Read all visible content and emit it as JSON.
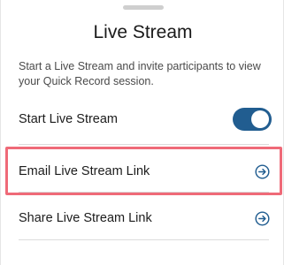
{
  "sheet": {
    "title": "Live Stream",
    "description": "Start a Live Stream and invite participants to view your Quick Record session."
  },
  "rows": {
    "start": {
      "label": "Start Live Stream",
      "toggle_on": true
    },
    "email": {
      "label": "Email Live Stream Link",
      "icon": "arrow-circle-right-icon"
    },
    "share": {
      "label": "Share Live Stream Link",
      "icon": "arrow-circle-right-icon"
    }
  },
  "colors": {
    "accent": "#215d90",
    "highlight": "#ef6a78"
  }
}
